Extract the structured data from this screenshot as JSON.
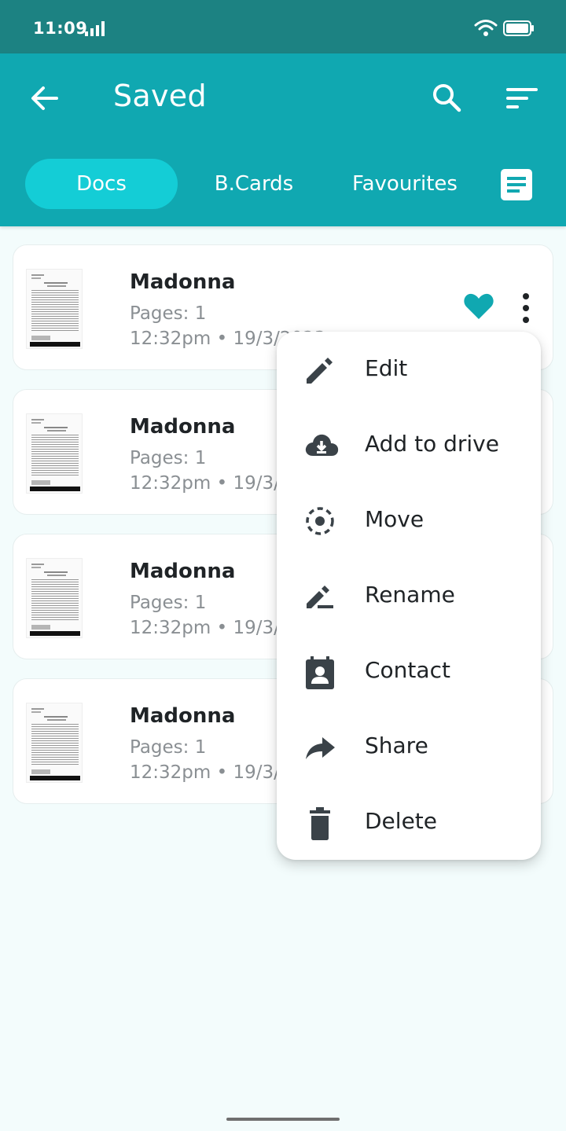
{
  "status_bar": {
    "time": "11:09"
  },
  "header": {
    "title": "Saved",
    "icons": [
      "back-arrow-icon",
      "search-icon",
      "sort-icon"
    ]
  },
  "tabs": [
    {
      "label": "Docs",
      "active": true
    },
    {
      "label": "B.Cards",
      "active": false
    },
    {
      "label": "Favourites",
      "active": false
    }
  ],
  "documents": [
    {
      "name": "Madonna",
      "pages": "Pages: 1",
      "date": "12:32pm • 19/3/2023",
      "favourite": true
    },
    {
      "name": "Madonna",
      "pages": "Pages: 1",
      "date": "12:32pm • 19/3/2023"
    },
    {
      "name": "Madonna",
      "pages": "Pages: 1",
      "date": "12:32pm • 19/3/2023"
    },
    {
      "name": "Madonna",
      "pages": "Pages: 1",
      "date": "12:32pm • 19/3/2023"
    }
  ],
  "context_menu": {
    "items": [
      {
        "label": "Edit",
        "icon": "pencil-icon"
      },
      {
        "label": "Add to drive",
        "icon": "cloud-download-icon"
      },
      {
        "label": "Move",
        "icon": "dashed-circle-icon"
      },
      {
        "label": "Rename",
        "icon": "rename-icon"
      },
      {
        "label": "Contact",
        "icon": "contact-icon"
      },
      {
        "label": "Share",
        "icon": "share-arrow-icon"
      },
      {
        "label": "Delete",
        "icon": "trash-icon"
      }
    ]
  },
  "colors": {
    "status_bar": "#1c8282",
    "app_bar": "#10a8b1",
    "active_tab": "#14cdd6",
    "heart": "#10a8b1",
    "background": "#f3fcfc",
    "menu_icon": "#3a4248"
  }
}
